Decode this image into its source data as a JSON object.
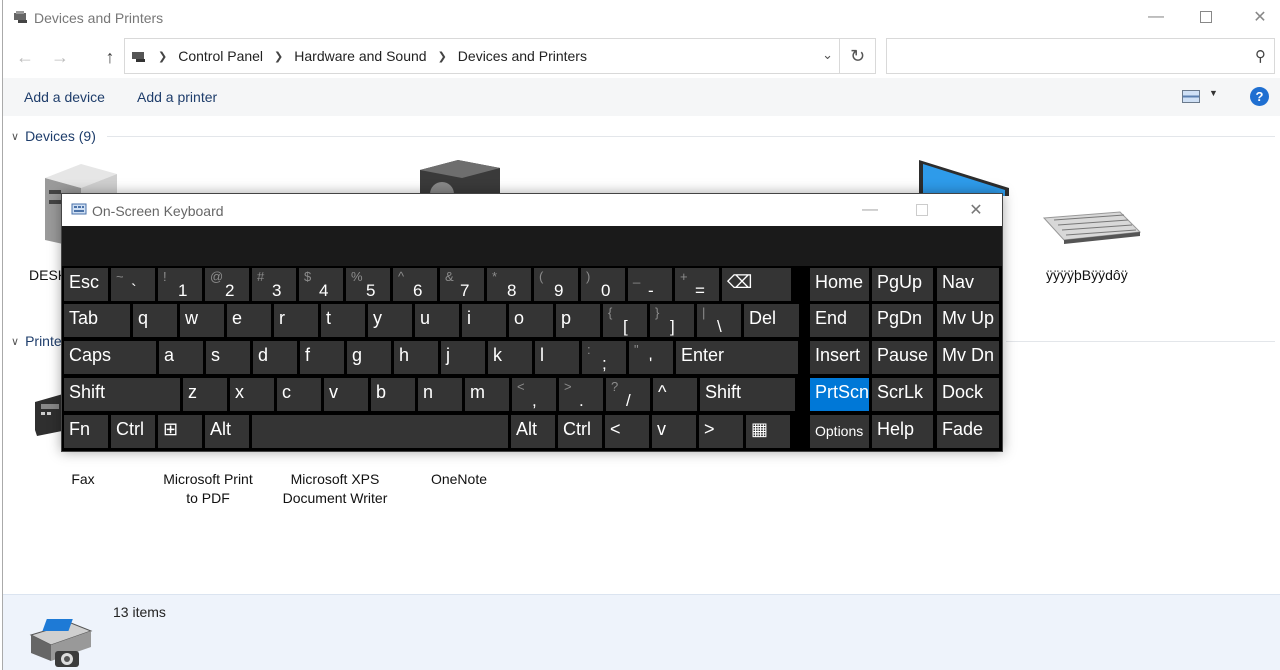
{
  "window": {
    "title": "Devices and Printers",
    "caption_buttons": [
      "minimize-icon",
      "maximize-icon",
      "close-icon"
    ]
  },
  "address": {
    "crumbs": [
      "Control Panel",
      "Hardware and Sound",
      "Devices and Printers"
    ],
    "search_placeholder": ""
  },
  "toolbar": {
    "add_device": "Add a device",
    "add_printer": "Add a printer"
  },
  "groups": {
    "devices_header": "Devices (9)",
    "printers_header": "Printers"
  },
  "devices": [
    {
      "label": "DESK",
      "icon": "desktop-tower-icon"
    },
    {
      "label": "",
      "icon": "speaker-device-icon"
    },
    {
      "label": "",
      "icon": "monitor-icon"
    },
    {
      "label": "ÿÿÿÿþBÿÿdôÿ",
      "icon": "keyboard-device-icon"
    }
  ],
  "printers": [
    {
      "label": "Fax",
      "icon": "fax-icon"
    },
    {
      "label_lines": [
        "Microsoft Print",
        "to PDF"
      ],
      "icon": "printer-icon"
    },
    {
      "label_lines": [
        "Microsoft XPS",
        "Document Writer"
      ],
      "icon": "printer-icon"
    },
    {
      "label": "OneNote",
      "icon": "printer-icon"
    }
  ],
  "status": {
    "count": "13 items",
    "icon": "printer-camera-icon"
  },
  "osk": {
    "title": "On-Screen Keyboard",
    "rows": [
      [
        {
          "main": "Esc"
        },
        {
          "shift": "~",
          "base": "`"
        },
        {
          "shift": "!",
          "base": "1"
        },
        {
          "shift": "@",
          "base": "2"
        },
        {
          "shift": "#",
          "base": "3"
        },
        {
          "shift": "$",
          "base": "4"
        },
        {
          "shift": "%",
          "base": "5"
        },
        {
          "shift": "^",
          "base": "6"
        },
        {
          "shift": "&",
          "base": "7"
        },
        {
          "shift": "*",
          "base": "8"
        },
        {
          "shift": "(",
          "base": "9"
        },
        {
          "shift": ")",
          "base": "0"
        },
        {
          "shift": "_",
          "base": "-"
        },
        {
          "shift": "+",
          "base": "="
        },
        {
          "main": "⌫"
        }
      ],
      [
        {
          "main": "Tab"
        },
        {
          "main": "q"
        },
        {
          "main": "w"
        },
        {
          "main": "e"
        },
        {
          "main": "r"
        },
        {
          "main": "t"
        },
        {
          "main": "y"
        },
        {
          "main": "u"
        },
        {
          "main": "i"
        },
        {
          "main": "o"
        },
        {
          "main": "p"
        },
        {
          "shift": "{",
          "base": "["
        },
        {
          "shift": "}",
          "base": "]"
        },
        {
          "shift": "|",
          "base": "\\"
        },
        {
          "main": "Del"
        }
      ],
      [
        {
          "main": "Caps"
        },
        {
          "main": "a"
        },
        {
          "main": "s"
        },
        {
          "main": "d"
        },
        {
          "main": "f"
        },
        {
          "main": "g"
        },
        {
          "main": "h"
        },
        {
          "main": "j"
        },
        {
          "main": "k"
        },
        {
          "main": "l"
        },
        {
          "shift": ":",
          "base": ";"
        },
        {
          "shift": "\"",
          "base": "'"
        },
        {
          "main": "Enter"
        }
      ],
      [
        {
          "main": "Shift"
        },
        {
          "main": "z"
        },
        {
          "main": "x"
        },
        {
          "main": "c"
        },
        {
          "main": "v"
        },
        {
          "main": "b"
        },
        {
          "main": "n"
        },
        {
          "main": "m"
        },
        {
          "shift": "<",
          "base": ","
        },
        {
          "shift": ">",
          "base": "."
        },
        {
          "shift": "?",
          "base": "/"
        },
        {
          "main": "^"
        },
        {
          "main": "Shift"
        }
      ],
      [
        {
          "main": "Fn"
        },
        {
          "main": "Ctrl"
        },
        {
          "main": "⊞"
        },
        {
          "main": "Alt"
        },
        {
          "main": ""
        },
        {
          "main": "Alt"
        },
        {
          "main": "Ctrl"
        },
        {
          "main": "<"
        },
        {
          "main": "v"
        },
        {
          "main": ">"
        },
        {
          "main": "▦"
        }
      ]
    ],
    "side_rows": [
      [
        {
          "main": "Home"
        },
        {
          "main": "PgUp"
        },
        {
          "main": "Nav"
        }
      ],
      [
        {
          "main": "End"
        },
        {
          "main": "PgDn"
        },
        {
          "main": "Mv Up"
        }
      ],
      [
        {
          "main": "Insert"
        },
        {
          "main": "Pause"
        },
        {
          "main": "Mv Dn"
        }
      ],
      [
        {
          "main": "PrtScn",
          "lit": true
        },
        {
          "main": "ScrLk"
        },
        {
          "main": "Dock"
        }
      ],
      [
        {
          "main": "Options",
          "small": true
        },
        {
          "main": "Help"
        },
        {
          "main": "Fade"
        }
      ]
    ],
    "accent": "#0078d7"
  }
}
